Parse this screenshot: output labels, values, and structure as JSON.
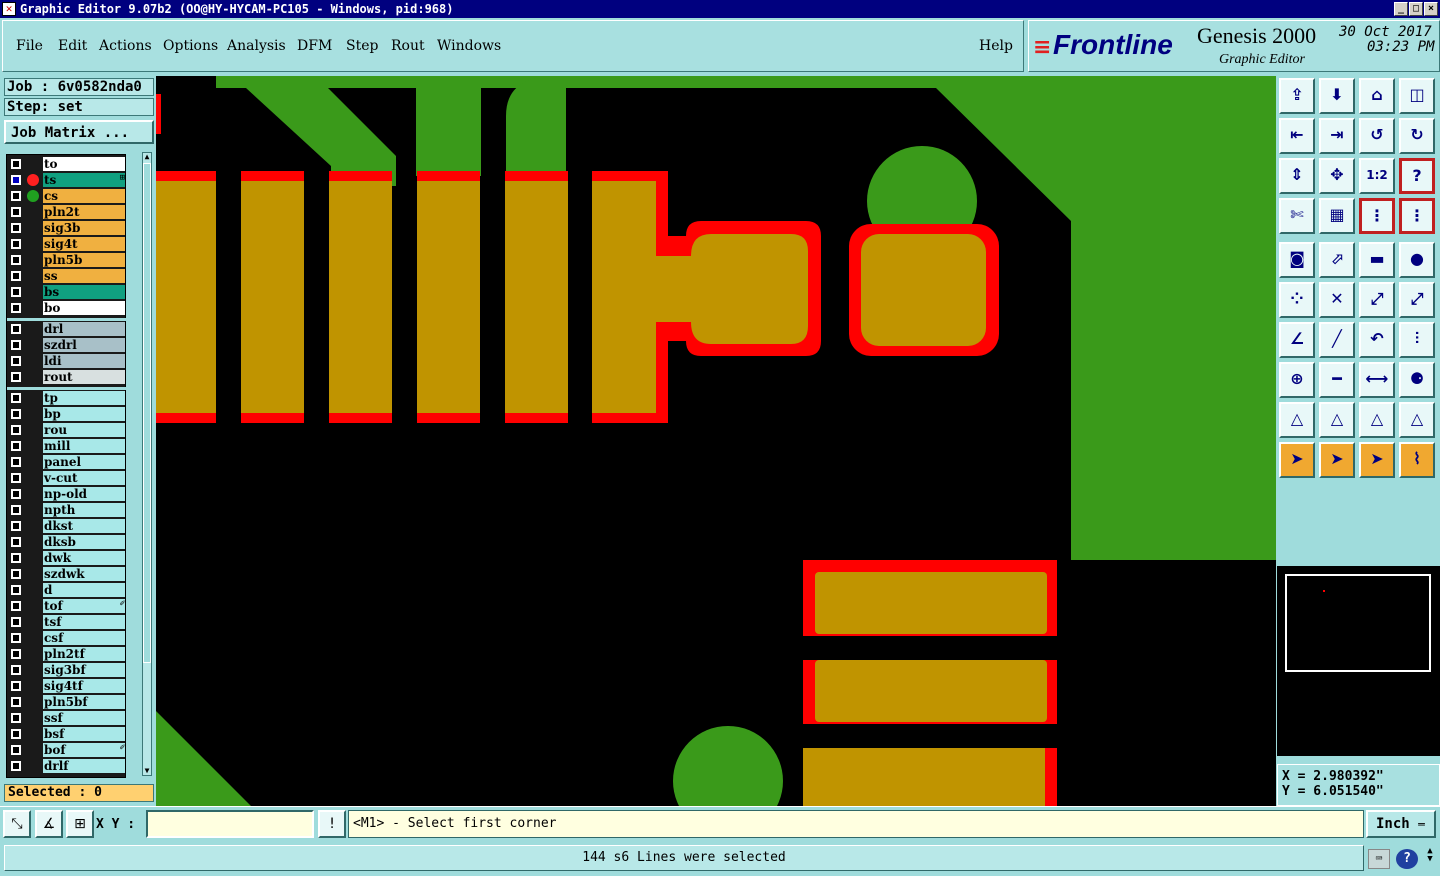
{
  "window": {
    "title": "Graphic Editor 9.07b2 (OO@HY-HYCAM-PC105 - Windows, pid:968)"
  },
  "menu": {
    "items": [
      "File",
      "Edit",
      "Actions",
      "Options",
      "Analysis",
      "DFM",
      "Step",
      "Rout",
      "Windows"
    ],
    "help": "Help"
  },
  "brand": {
    "logo": "Frontline",
    "product": "Genesis 2000",
    "subtitle": "Graphic Editor",
    "date": "30 Oct 2017",
    "time": "03:23 PM"
  },
  "job": {
    "job_label": "Job : 6v0582nda0",
    "step_label": "Step: set",
    "matrix_button": "Job Matrix ..."
  },
  "layers": {
    "group1": [
      {
        "name": "to",
        "color": "#ffffff",
        "mark": ""
      },
      {
        "name": "ts",
        "color": "#10a080",
        "mark": "#ff2020",
        "suffix": "⊞"
      },
      {
        "name": "cs",
        "color": "#f0b040",
        "mark": "#20a020"
      },
      {
        "name": "pln2t",
        "color": "#f0b040",
        "mark": ""
      },
      {
        "name": "sig3b",
        "color": "#f0b040",
        "mark": ""
      },
      {
        "name": "sig4t",
        "color": "#f0b040",
        "mark": ""
      },
      {
        "name": "pln5b",
        "color": "#f0b040",
        "mark": ""
      },
      {
        "name": "ss",
        "color": "#f0b040",
        "mark": ""
      },
      {
        "name": "bs",
        "color": "#10a080",
        "mark": ""
      },
      {
        "name": "bo",
        "color": "#ffffff",
        "mark": ""
      }
    ],
    "group2": [
      {
        "name": "drl",
        "color": "#a8c0c8",
        "mark": ""
      },
      {
        "name": "szdrl",
        "color": "#a8c0c8",
        "mark": ""
      },
      {
        "name": "ldi",
        "color": "#a8c0c8",
        "mark": ""
      },
      {
        "name": "rout",
        "color": "#d8e0e0",
        "mark": ""
      }
    ],
    "group3": [
      {
        "name": "tp"
      },
      {
        "name": "bp"
      },
      {
        "name": "rou"
      },
      {
        "name": "mill"
      },
      {
        "name": "panel"
      },
      {
        "name": "v-cut"
      },
      {
        "name": "np-old"
      },
      {
        "name": "npth"
      },
      {
        "name": "dkst"
      },
      {
        "name": "dksb"
      },
      {
        "name": "dwk"
      },
      {
        "name": "szdwk"
      },
      {
        "name": "d"
      },
      {
        "name": "tof",
        "suffix": "✐"
      },
      {
        "name": "tsf"
      },
      {
        "name": "csf"
      },
      {
        "name": "pln2tf"
      },
      {
        "name": "sig3bf"
      },
      {
        "name": "sig4tf"
      },
      {
        "name": "pln5bf"
      },
      {
        "name": "ssf"
      },
      {
        "name": "bsf"
      },
      {
        "name": "bof",
        "suffix": "✐"
      },
      {
        "name": "drlf"
      }
    ]
  },
  "selection": {
    "label": "Selected : 0"
  },
  "coords": {
    "x": "X = 2.980392\"",
    "y": "Y = 6.051540\""
  },
  "command": {
    "xy_label": "X Y :",
    "xy_value": "",
    "prompt": "<M1> - Select first corner",
    "unit": "Inch"
  },
  "status": {
    "message": "144 s6 Lines were selected"
  },
  "colors": {
    "copper": "#c09400",
    "mask": "#ff0000",
    "plane": "#3a9a1a",
    "background": "#000000"
  },
  "toolbar_icons": [
    "home-icon",
    "screen-icon",
    "house-icon",
    "split-view-icon",
    "prev-icon",
    "next-icon",
    "undo-icon",
    "redo-icon",
    "fit-icon",
    "center-icon",
    "scale-icon",
    "help-icon",
    "measure-icon",
    "grid-icon",
    "layers-icon",
    "layers2-icon",
    "snapshot-icon",
    "edit-icon",
    "ruler-icon",
    "circle-icon",
    "node-icon",
    "cross-icon",
    "point-icon",
    "point2-icon",
    "angle-icon",
    "line-icon",
    "arc-icon",
    "text-icon",
    "add-pad-icon",
    "line-add-icon",
    "dim-icon",
    "shapes-icon",
    "tri-icon",
    "tri2-icon",
    "tri3-icon",
    "tri4-icon",
    "pointer-icon",
    "pointer2-icon",
    "pointer3-icon",
    "route-icon"
  ]
}
